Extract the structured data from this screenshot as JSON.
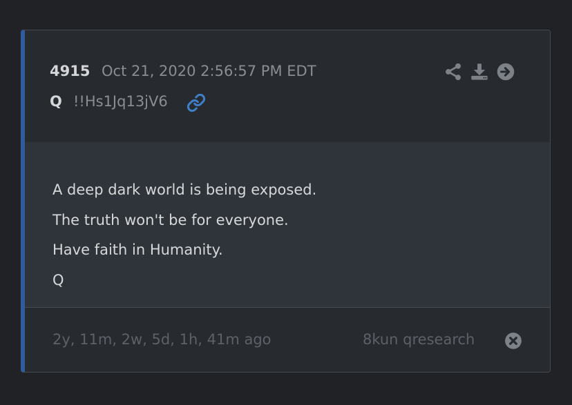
{
  "post": {
    "number": "4915",
    "date": "Oct 21, 2020 2:56:57 PM EDT",
    "author": "Q",
    "tripcode": "!!Hs1Jq13jV6",
    "body_lines": [
      "A deep dark world is being exposed.",
      "The truth won't be for everyone.",
      "Have faith in Humanity.",
      "Q"
    ],
    "elapsed": "2y, 11m, 2w, 5d, 1h, 41m ago",
    "source": "8kun qresearch"
  },
  "icons": {
    "link": "link-icon",
    "share": "share-icon",
    "download": "download-icon",
    "go": "arrow-right-circle-icon",
    "dismiss": "close-circle-icon"
  },
  "colors": {
    "accent_bar": "#2f5d9c",
    "link_icon": "#3f7fc7",
    "icon_gray": "#7d8288"
  }
}
